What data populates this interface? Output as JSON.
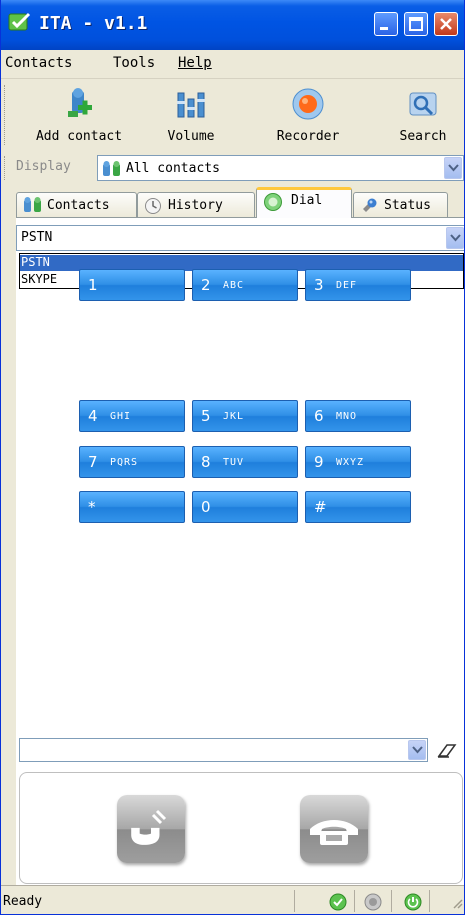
{
  "window": {
    "title": "ITA - v1.1"
  },
  "menu": {
    "contacts": "Contacts",
    "tools": "Tools",
    "help": "Help"
  },
  "toolbar": {
    "add_contact": "Add contact",
    "volume": "Volume",
    "recorder": "Recorder",
    "search": "Search"
  },
  "display": {
    "label": "Display",
    "value": "All contacts"
  },
  "tabs": {
    "contacts": "Contacts",
    "history": "History",
    "dial": "Dial",
    "status": "Status"
  },
  "dial": {
    "protocol": "PSTN",
    "protocol_options": [
      "PSTN",
      "SKYPE"
    ],
    "number_value": "",
    "keys": [
      {
        "digit": "1",
        "letters": ""
      },
      {
        "digit": "2",
        "letters": "ABC"
      },
      {
        "digit": "3",
        "letters": "DEF"
      },
      {
        "digit": "4",
        "letters": "GHI"
      },
      {
        "digit": "5",
        "letters": "JKL"
      },
      {
        "digit": "6",
        "letters": "MNO"
      },
      {
        "digit": "7",
        "letters": "PQRS"
      },
      {
        "digit": "8",
        "letters": "TUV"
      },
      {
        "digit": "9",
        "letters": "WXYZ"
      },
      {
        "digit": "*",
        "letters": ""
      },
      {
        "digit": "0",
        "letters": ""
      },
      {
        "digit": "#",
        "letters": ""
      }
    ]
  },
  "status": {
    "text": "Ready"
  },
  "colors": {
    "title_bar": "#0054e3",
    "key_blue": "#2f8fe6",
    "selection": "#316ac5",
    "active_tab": "#ffc83c"
  },
  "icons": {
    "add_contact": "add-contact-icon",
    "volume": "volume-icon",
    "recorder": "recorder-icon",
    "search": "search-icon",
    "call": "phone-call-icon",
    "hangup": "phone-hangup-icon",
    "eraser": "eraser-icon"
  }
}
